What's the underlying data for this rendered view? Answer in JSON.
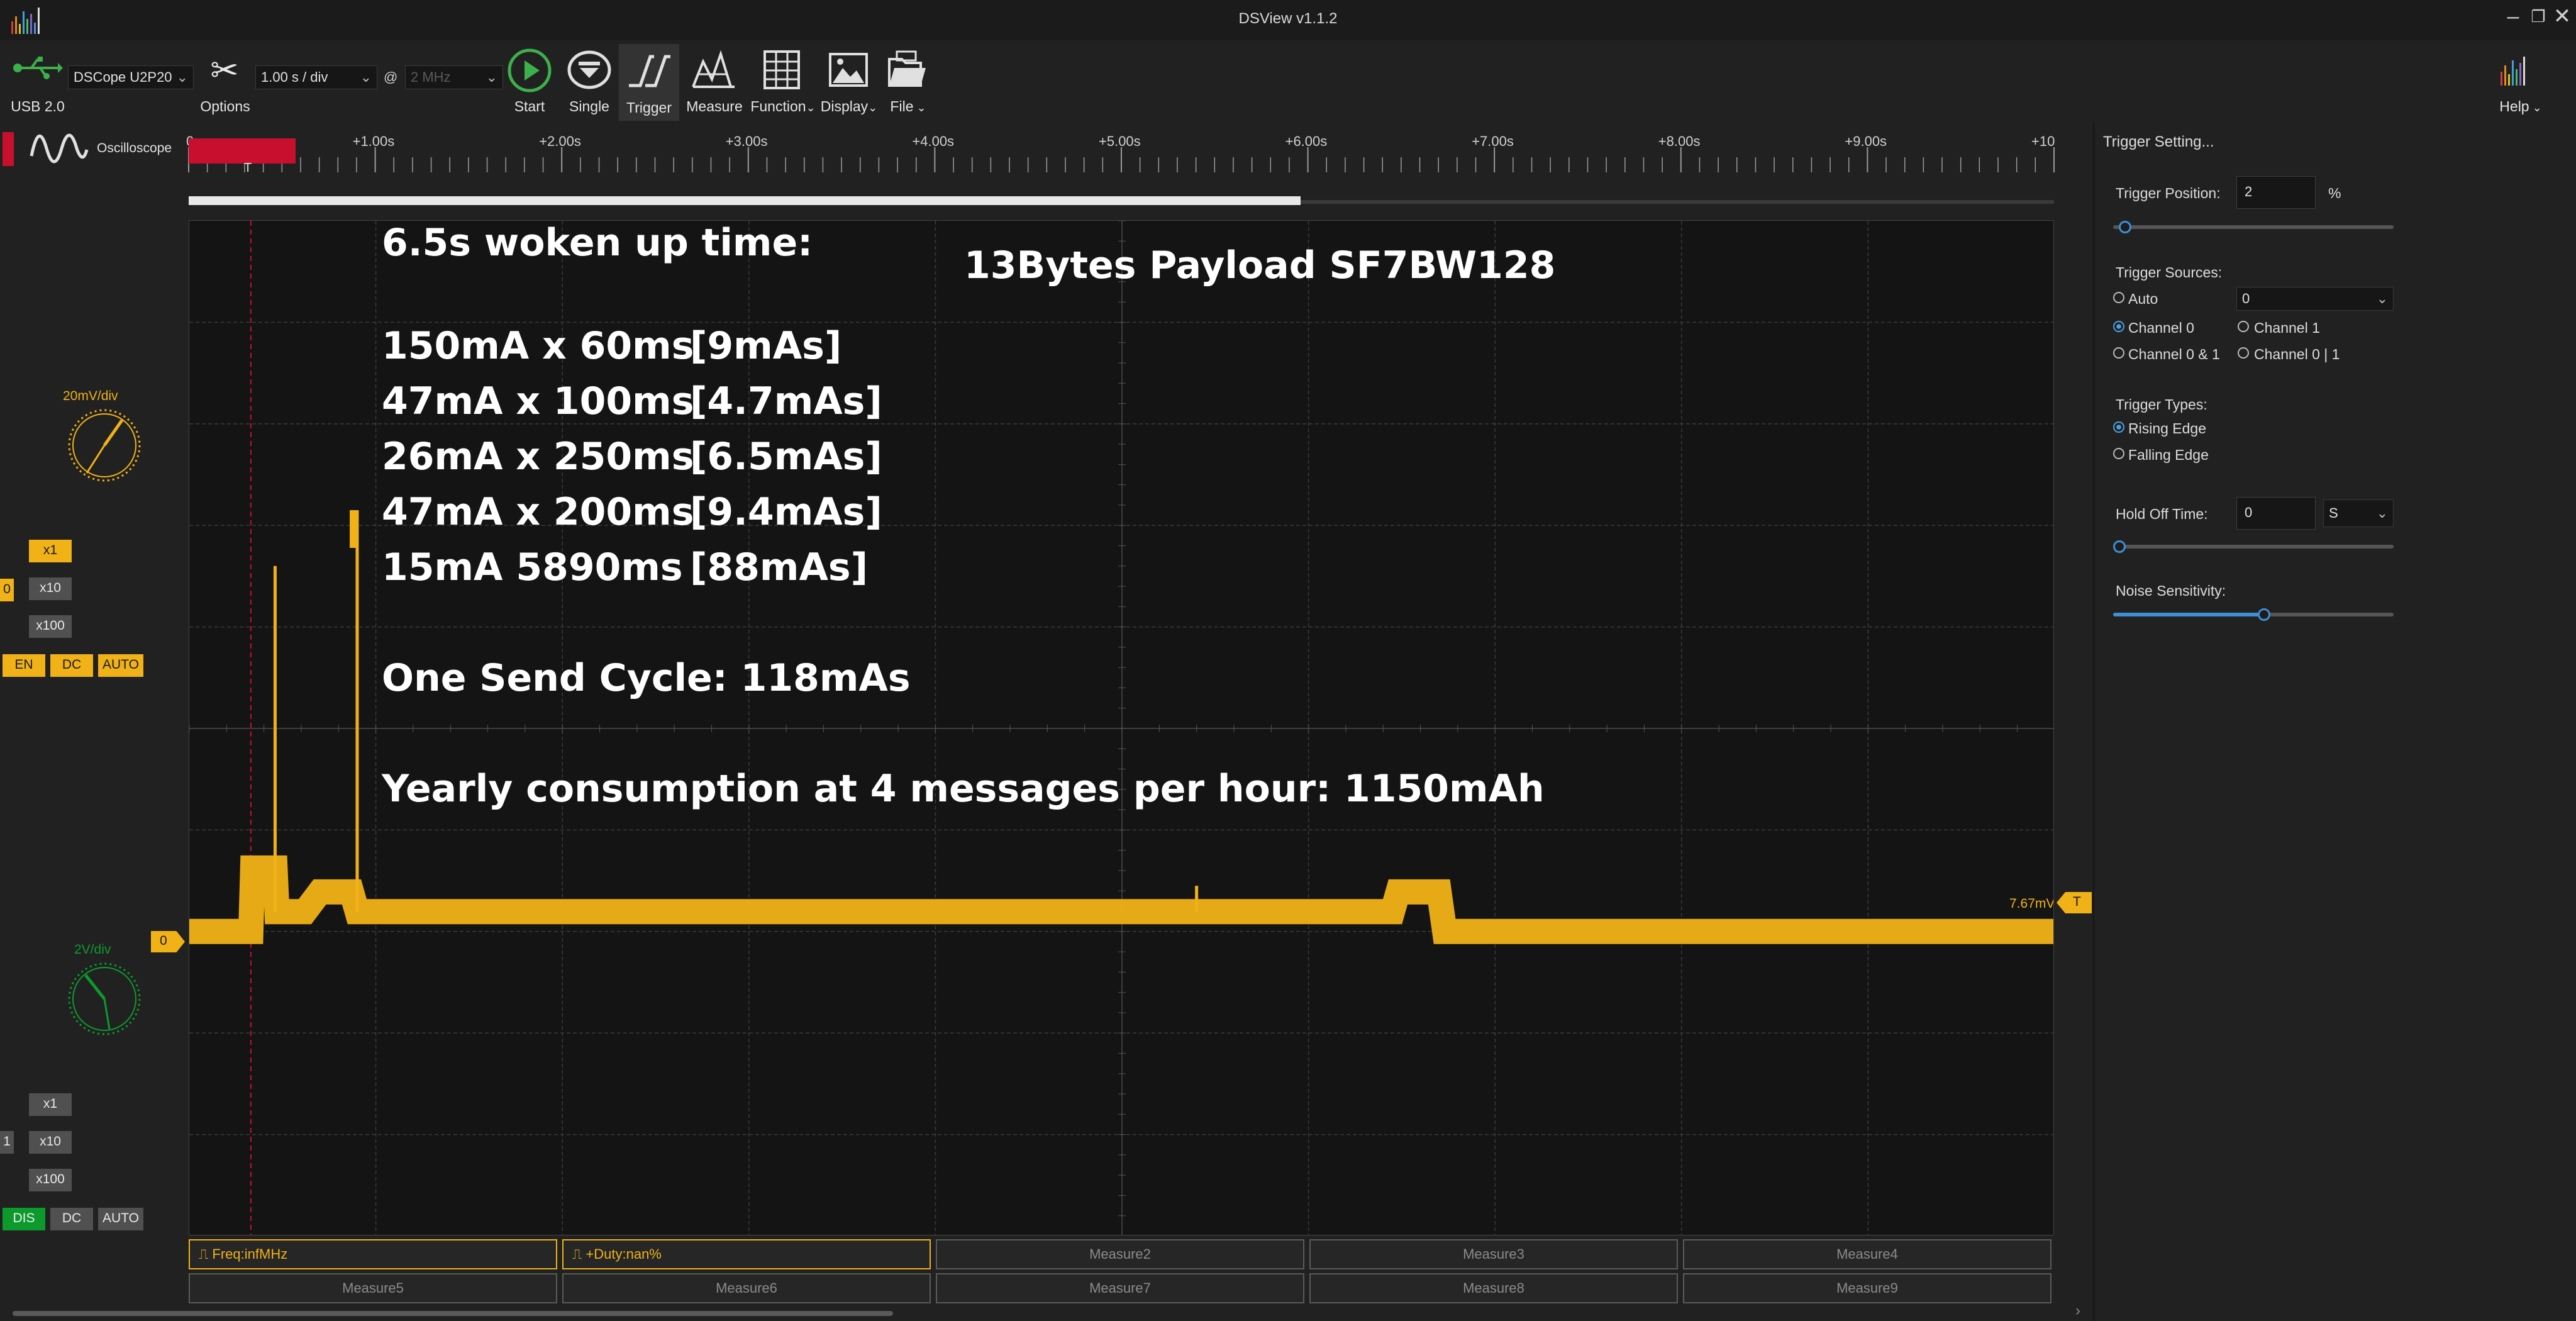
{
  "window": {
    "title": "DSView v1.1.2"
  },
  "toolbar": {
    "usb_label": "USB 2.0",
    "device": "DSCope U2P20",
    "options": "Options",
    "timebase": "1.00 s / div",
    "at_sign": "@",
    "samplerate": "2 MHz",
    "start": "Start",
    "single": "Single",
    "trigger": "Trigger",
    "measure": "Measure",
    "function": "Function",
    "display": "Display",
    "file": "File",
    "help": "Help"
  },
  "mode": {
    "label": "Oscilloscope"
  },
  "ruler": {
    "ticks": [
      "0s",
      "+1.00s",
      "+2.00s",
      "+3.00s",
      "+4.00s",
      "+5.00s",
      "+6.00s",
      "+7.00s",
      "+8.00s",
      "+9.00s",
      "+10"
    ],
    "trigger_marker": "T"
  },
  "channel0": {
    "vdiv": "20mV/div",
    "index": "0",
    "x1": "x1",
    "x10": "x10",
    "x100": "x100",
    "enable": "EN",
    "coupling": "DC",
    "auto": "AUTO",
    "color": "#f0b216",
    "level_value": "7.67mV",
    "level_marker": "T",
    "ground_marker": "0"
  },
  "channel1": {
    "vdiv": "2V/div",
    "index": "1",
    "x1": "x1",
    "x10": "x10",
    "x100": "x100",
    "enable": "DIS",
    "coupling": "DC",
    "auto": "AUTO",
    "color": "#0c9a2c"
  },
  "overlay": {
    "heading": "6.5s woken up time:",
    "payload": "13Bytes Payload SF7BW128",
    "rows": [
      {
        "current": "150mA x 60ms",
        "charge": "[9mAs]"
      },
      {
        "current": "47mA x 100ms",
        "charge": "[4.7mAs]"
      },
      {
        "current": "26mA x 250ms",
        "charge": "[6.5mAs]"
      },
      {
        "current": "47mA x 200ms",
        "charge": "[9.4mAs]"
      },
      {
        "current": "15mA 5890ms",
        "charge": "[88mAs]"
      }
    ],
    "cycle": "One Send Cycle: 118mAs",
    "yearly": "Yearly consumption at 4 messages per hour: 1150mAh"
  },
  "measures": {
    "row1": [
      "Freq:infMHz",
      "+Duty:nan%",
      "Measure2",
      "Measure3",
      "Measure4"
    ],
    "row2": [
      "Measure5",
      "Measure6",
      "Measure7",
      "Measure8",
      "Measure9"
    ]
  },
  "trigger_panel": {
    "title": "Trigger Setting...",
    "position_label": "Trigger Position:",
    "position_value": "2",
    "position_unit": "%",
    "sources_label": "Trigger Sources:",
    "src_auto": "Auto",
    "src_auto_value": "0",
    "src_ch0": "Channel 0",
    "src_ch1": "Channel 1",
    "src_ch0_and_1": "Channel 0 & 1",
    "src_ch0_or_1": "Channel 0 | 1",
    "types_label": "Trigger Types:",
    "type_rising": "Rising Edge",
    "type_falling": "Falling Edge",
    "holdoff_label": "Hold Off Time:",
    "holdoff_value": "0",
    "holdoff_unit": "S",
    "noise_label": "Noise Sensitivity:",
    "position_fraction": 0.02,
    "holdoff_fraction": 0.0,
    "noise_fraction": 0.54
  },
  "waveform": {
    "samples_s": [
      0,
      0.33,
      0.34,
      0.46,
      0.47,
      0.62,
      0.7,
      0.87,
      0.9,
      0.92,
      1.0,
      5.4,
      5.42,
      6.45,
      6.48,
      6.7,
      6.73,
      10
    ],
    "levels_mv": [
      0,
      0,
      12.5,
      12.5,
      3.9,
      3.9,
      7.8,
      7.8,
      3.9,
      3.9,
      3.9,
      3.9,
      3.9,
      3.9,
      7.8,
      7.8,
      0,
      0
    ]
  }
}
